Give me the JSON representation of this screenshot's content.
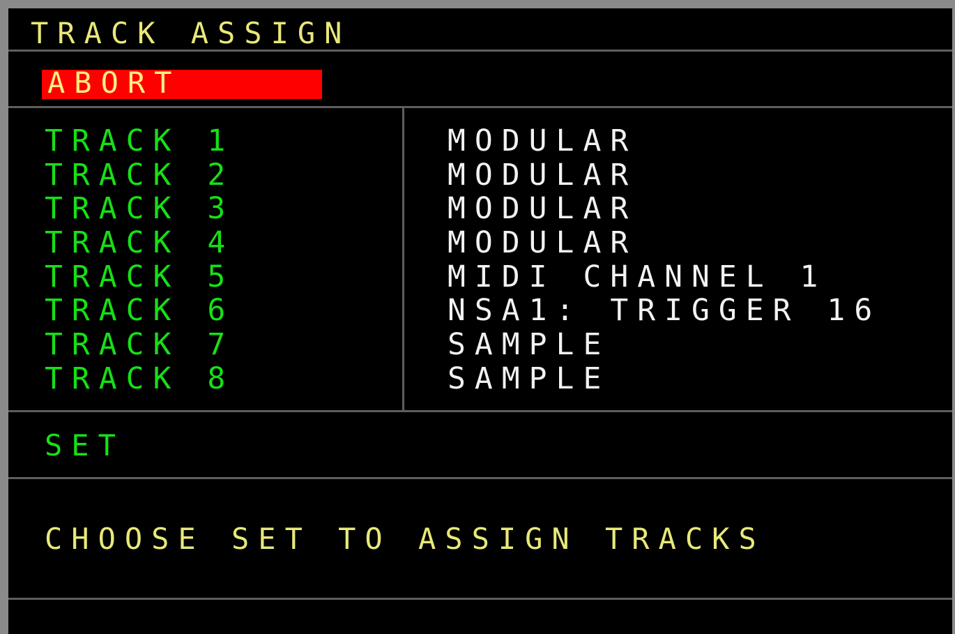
{
  "screen": {
    "title": "TRACK ASSIGN",
    "abort_label": "ABORT",
    "tracks": [
      {
        "label": "TRACK 1",
        "assignment": "MODULAR"
      },
      {
        "label": "TRACK 2",
        "assignment": "MODULAR"
      },
      {
        "label": "TRACK 3",
        "assignment": "MODULAR"
      },
      {
        "label": "TRACK 4",
        "assignment": "MODULAR"
      },
      {
        "label": "TRACK 5",
        "assignment": "MIDI CHANNEL 1"
      },
      {
        "label": "TRACK 6",
        "assignment": "NSA1: TRIGGER 16"
      },
      {
        "label": "TRACK 7",
        "assignment": "SAMPLE"
      },
      {
        "label": "TRACK 8",
        "assignment": "SAMPLE"
      }
    ],
    "set_label": "SET",
    "message": "CHOOSE SET TO ASSIGN TRACKS"
  },
  "colors": {
    "background": "#000000",
    "title_text": "#e8e87a",
    "track_label_text": "#16e016",
    "assignment_text": "#f2f2f2",
    "abort_bg": "#ff0000",
    "abort_text": "#ffef80",
    "divider": "#5e5e5e",
    "frame": "#8a8a8a"
  }
}
